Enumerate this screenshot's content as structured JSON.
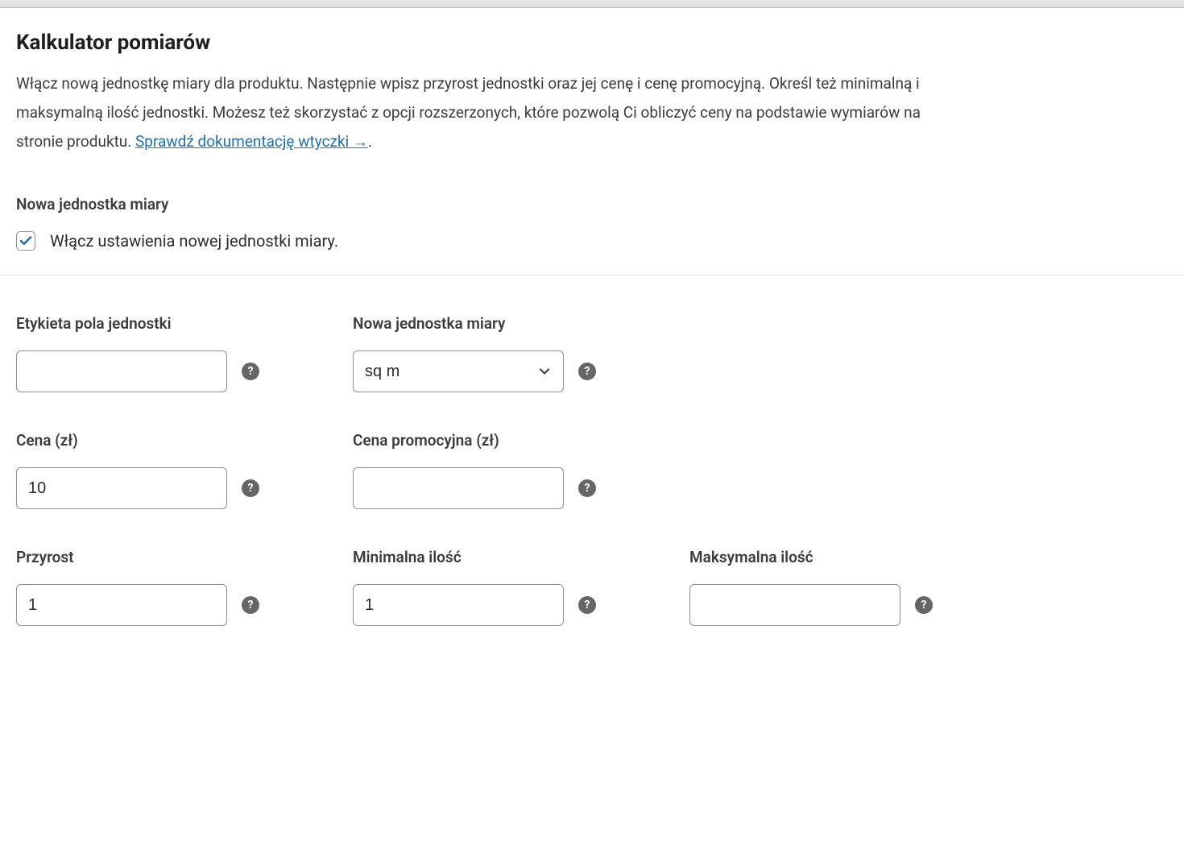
{
  "heading": "Kalkulator pomiarów",
  "description_text": "Włącz nową jednostkę miary dla produktu. Następnie wpisz przyrost jednostki oraz jej cenę i cenę promocyjną. Określ też minimalną i maksymalną ilość jednostki. Możesz też skorzystać z opcji rozszerzonych, które pozwolą Ci obliczyć ceny na podstawie wymiarów na stronie produktu. ",
  "description_link": "Sprawdź dokumentację wtyczki →",
  "description_period": ".",
  "enable_section_label": "Nowa jednostka miary",
  "enable_checkbox_label": "Włącz ustawienia nowej jednostki miary.",
  "enable_checked": true,
  "fields": {
    "unit_label": {
      "label": "Etykieta pola jednostki",
      "value": ""
    },
    "unit_select": {
      "label": "Nowa jednostka miary",
      "value": "sq m"
    },
    "price": {
      "label": "Cena (zł)",
      "value": "10"
    },
    "sale_price": {
      "label": "Cena promocyjna (zł)",
      "value": ""
    },
    "increment": {
      "label": "Przyrost",
      "value": "1"
    },
    "min_qty": {
      "label": "Minimalna ilość",
      "value": "1"
    },
    "max_qty": {
      "label": "Maksymalna ilość",
      "value": ""
    }
  }
}
